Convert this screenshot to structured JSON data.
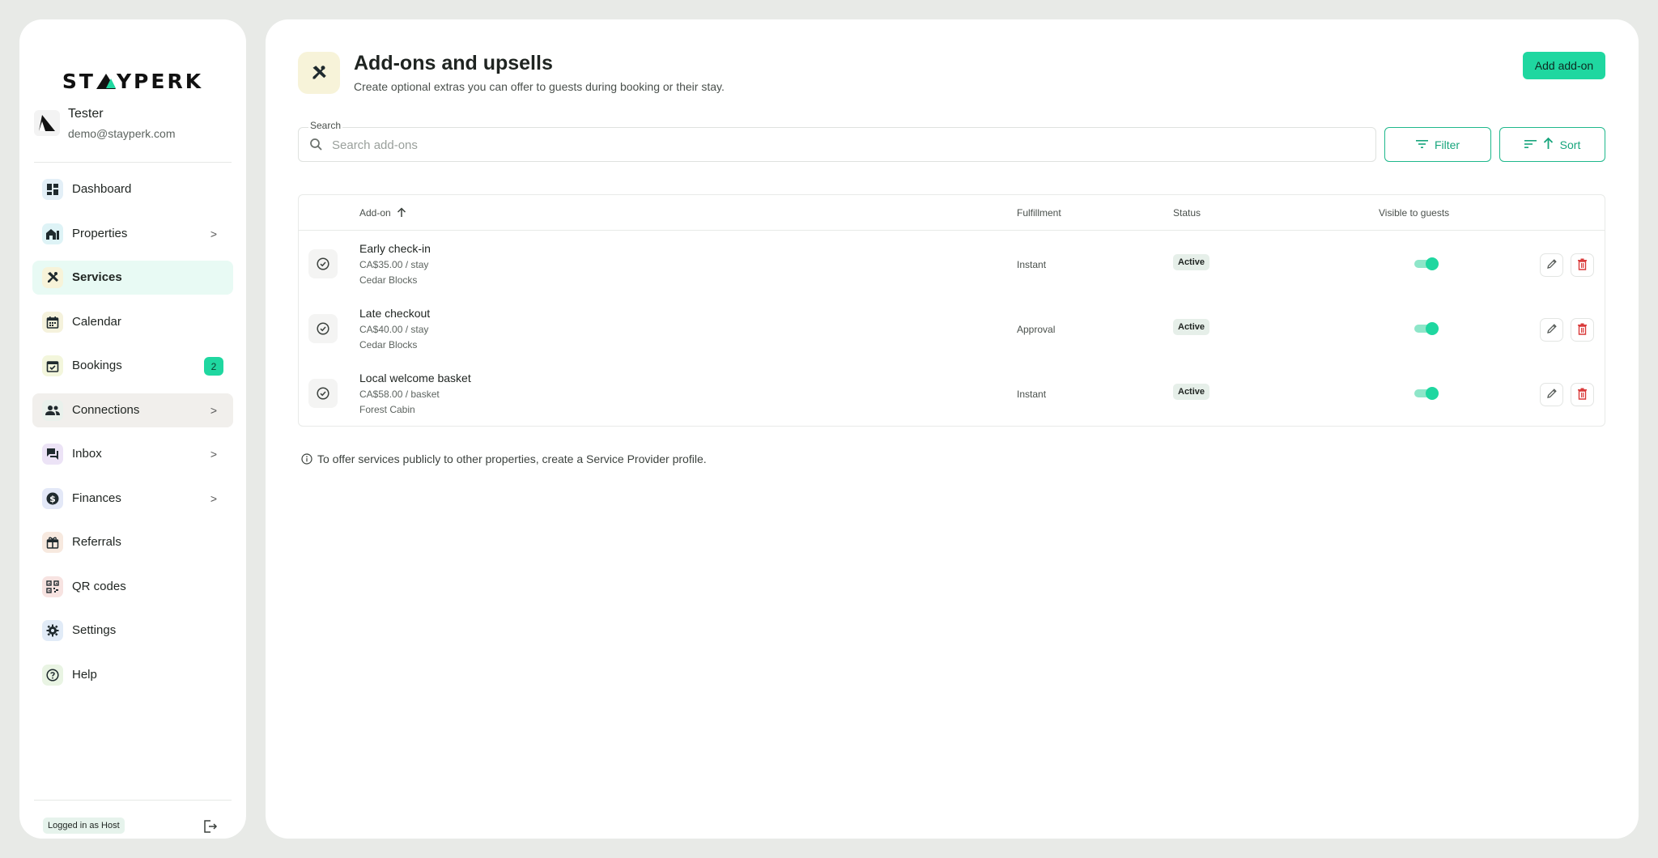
{
  "brand": {
    "logo_text_left": "ST",
    "logo_text_right": "YPERK",
    "accent": "#1fd7a0"
  },
  "user": {
    "name": "Tester",
    "email": "demo@stayperk.com"
  },
  "sidebar": {
    "items": [
      {
        "label": "Dashboard",
        "icon": "dashboard-icon"
      },
      {
        "label": "Properties",
        "icon": "properties-icon",
        "chevron": ">"
      },
      {
        "label": "Services",
        "icon": "services-icon",
        "active": true
      },
      {
        "label": "Calendar",
        "icon": "calendar-icon"
      },
      {
        "label": "Bookings",
        "icon": "bookings-icon",
        "badge": "2"
      },
      {
        "label": "Connections",
        "icon": "connections-icon",
        "chevron": ">"
      },
      {
        "label": "Inbox",
        "icon": "inbox-icon",
        "chevron": ">"
      },
      {
        "label": "Finances",
        "icon": "finances-icon",
        "chevron": ">"
      },
      {
        "label": "Referrals",
        "icon": "referrals-icon"
      },
      {
        "label": "QR codes",
        "icon": "qr-icon"
      },
      {
        "label": "Settings",
        "icon": "settings-icon"
      },
      {
        "label": "Help",
        "icon": "help-icon"
      }
    ],
    "footer": {
      "role_label": "Logged in as Host"
    }
  },
  "header": {
    "title": "Add-ons and upsells",
    "subtitle": "Create optional extras you can offer to guests during booking or their stay.",
    "add_button": "Add add-on"
  },
  "search": {
    "label": "Search",
    "placeholder": "Search add-ons",
    "value": ""
  },
  "toolbar": {
    "filter_label": "Filter",
    "sort_label": "Sort"
  },
  "table": {
    "columns": [
      "Add-on",
      "Fulfillment",
      "Status",
      "Visible to guests"
    ],
    "sort_indicator": "↑",
    "rows": [
      {
        "name": "Early check-in",
        "price": "CA$35.00 / stay",
        "property": "Cedar Blocks",
        "fulfillment": "Instant",
        "status": "Active",
        "visible": true
      },
      {
        "name": "Late checkout",
        "price": "CA$40.00 / stay",
        "property": "Cedar Blocks",
        "fulfillment": "Approval",
        "status": "Active",
        "visible": true
      },
      {
        "name": "Local welcome basket",
        "price": "CA$58.00 / basket",
        "property": "Forest Cabin",
        "fulfillment": "Instant",
        "status": "Active",
        "visible": true
      }
    ]
  },
  "info_note": "To offer services publicly to other properties, create a Service Provider profile."
}
